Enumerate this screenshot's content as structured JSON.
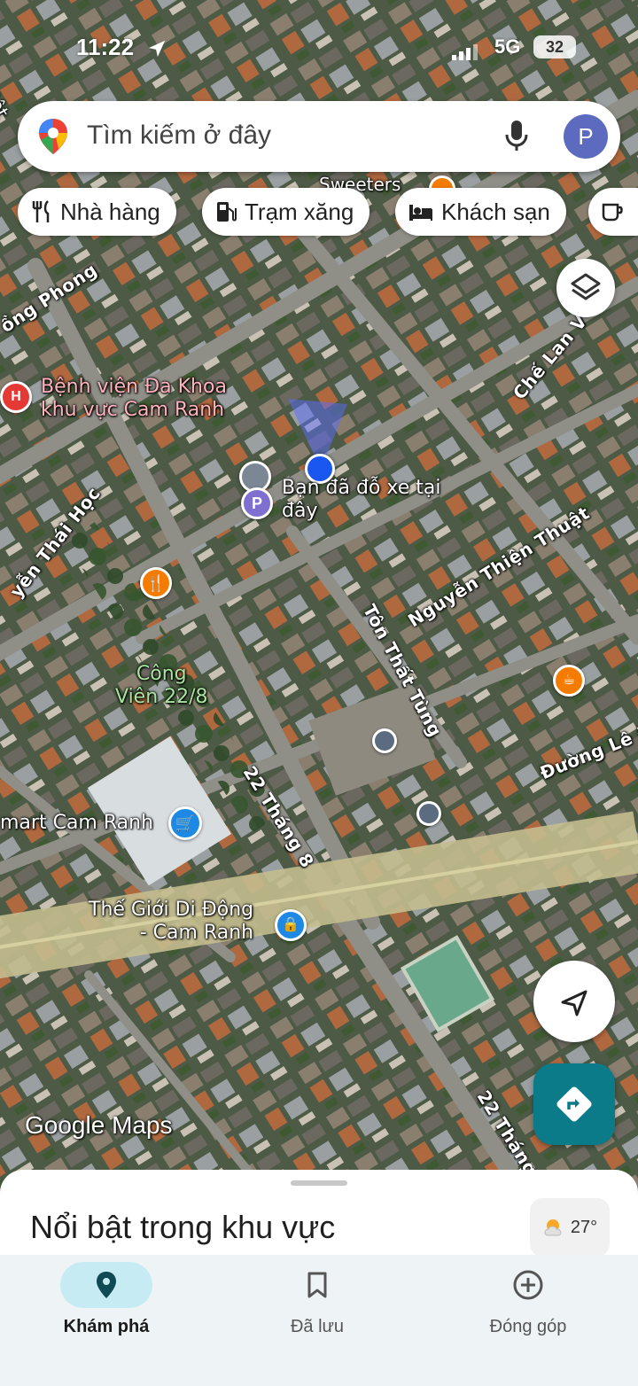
{
  "status_bar": {
    "time": "11:22",
    "network": "5G",
    "battery": "32"
  },
  "search": {
    "placeholder": "Tìm kiếm ở đây",
    "avatar_letter": "P"
  },
  "chips": [
    {
      "label": "Nhà hàng",
      "icon": "restaurant-icon"
    },
    {
      "label": "Trạm xăng",
      "icon": "gas-station-icon"
    },
    {
      "label": "Khách sạn",
      "icon": "hotel-icon"
    }
  ],
  "map_labels": {
    "street_viet": "Việt",
    "street_dong_phong": "ồng Phong",
    "hospital": "Bệnh viện Đa Khoa\nkhu vực Cam Ranh",
    "che_lan_vien": "Chế Lan V",
    "parked_message": "Bạn đã đỗ xe tại\nđây",
    "nguyen_thai_hoc": "yễn Thái Học",
    "nguyen_thien_thuat": "Nguyễn Thiện Thuật",
    "ton_that_tung": "Tôn Thất Tùng",
    "park": "Công\nViên 22/8",
    "duong_le": "Đường Lê Đ",
    "mart": "mart Cam Ranh",
    "street_22_thang_8": "22 Tháng 8",
    "the_gioi_di_dong": "Thế Giới Di Động\n- Cam Ranh",
    "street_22_thang_8_b": "22 Tháng",
    "sweeters": "Sweeters"
  },
  "attribution": "Google Maps",
  "sheet": {
    "title": "Nổi bật trong khu vực",
    "temperature": "27°"
  },
  "bottom_nav": [
    {
      "label": "Khám phá",
      "icon": "explore-pin-icon",
      "active": true
    },
    {
      "label": "Đã lưu",
      "icon": "bookmark-icon",
      "active": false
    },
    {
      "label": "Đóng góp",
      "icon": "add-circle-icon",
      "active": false
    }
  ],
  "colors": {
    "accent": "#0b7b8a",
    "active_pill": "#c7ebf2",
    "location_dot": "#1a56f0",
    "avatar": "#5c6bc0",
    "poi_orange": "#f57c00",
    "poi_blue": "#1e88e5",
    "poi_red": "#e53935"
  }
}
